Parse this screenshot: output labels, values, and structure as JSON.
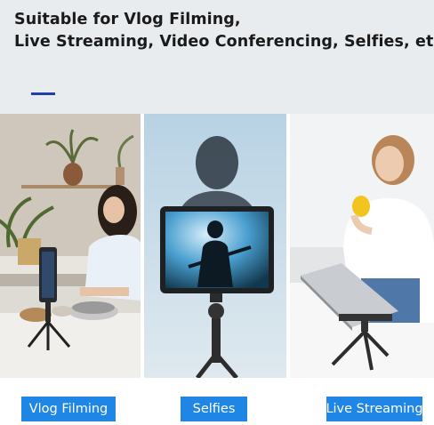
{
  "headline": {
    "line1": "Suitable for Vlog Filming,",
    "line2": "Live Streaming, Video Conferencing, Selfies, etc."
  },
  "colors": {
    "accent": "#1f3fb0",
    "label_background": "#1f86e6",
    "header_background": "#e9ecee"
  },
  "panels": [
    {
      "label": "Vlog Filming"
    },
    {
      "label": "Selfies"
    },
    {
      "label": "Live Streaming"
    }
  ]
}
